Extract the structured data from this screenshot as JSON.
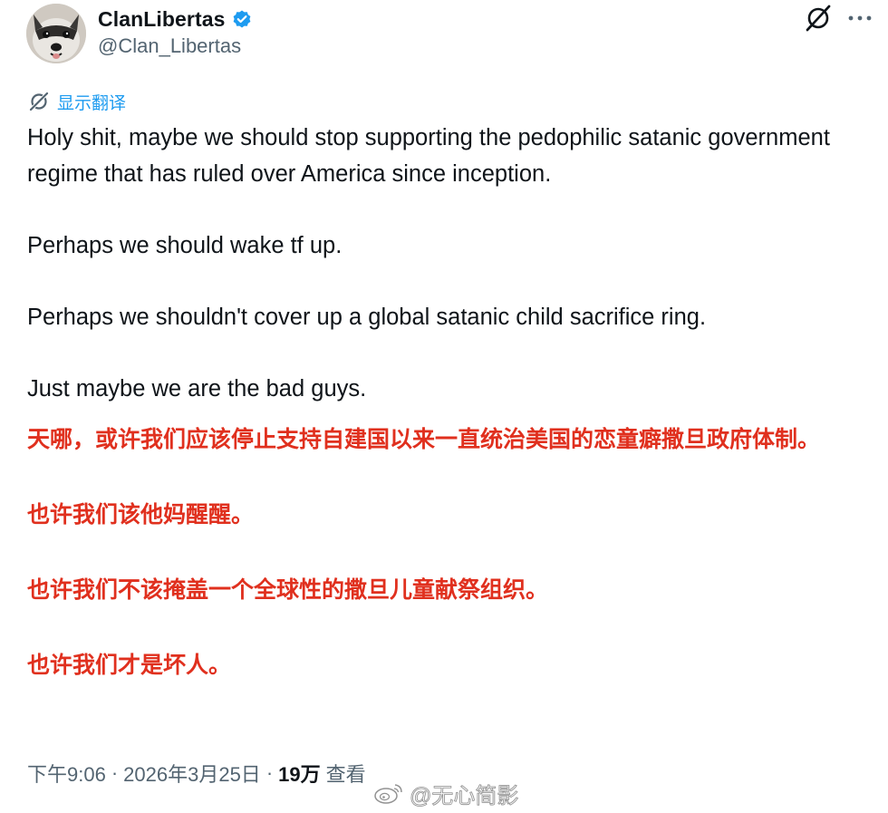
{
  "author": {
    "display_name": "ClanLibertas",
    "handle": "@Clan_Libertas",
    "verified": true,
    "verified_color": "#1d9bf0",
    "avatar_icon": "raccoon-avatar"
  },
  "header_actions": {
    "grok_icon": "grok-icon",
    "more_icon": "more-horizontal-icon"
  },
  "translate": {
    "label": "显示翻译",
    "color": "#1d9bf0"
  },
  "tweet": {
    "paragraphs": [
      "Holy shit, maybe we should stop supporting the pedophilic satanic government regime that has ruled over America since inception.",
      "Perhaps we should wake tf up.",
      "Perhaps we shouldn't cover up a global satanic child sacrifice ring.",
      "Just maybe we are the bad guys."
    ]
  },
  "translation_overlay": {
    "color": "#e0301e",
    "paragraphs": [
      "天哪，或许我们应该停止支持自建国以来一直统治美国的恋童癖撒旦政府体制。",
      "也许我们该他妈醒醒。",
      "也许我们不该掩盖一个全球性的撒旦儿童献祭组织。",
      "也许我们才是坏人。"
    ]
  },
  "meta": {
    "time": "下午9:06",
    "date": "2026年3月25日",
    "views_count": "19万",
    "views_label": "查看",
    "separator": "·"
  },
  "watermark": {
    "text": "@无心简影",
    "icon": "weibo-icon"
  }
}
